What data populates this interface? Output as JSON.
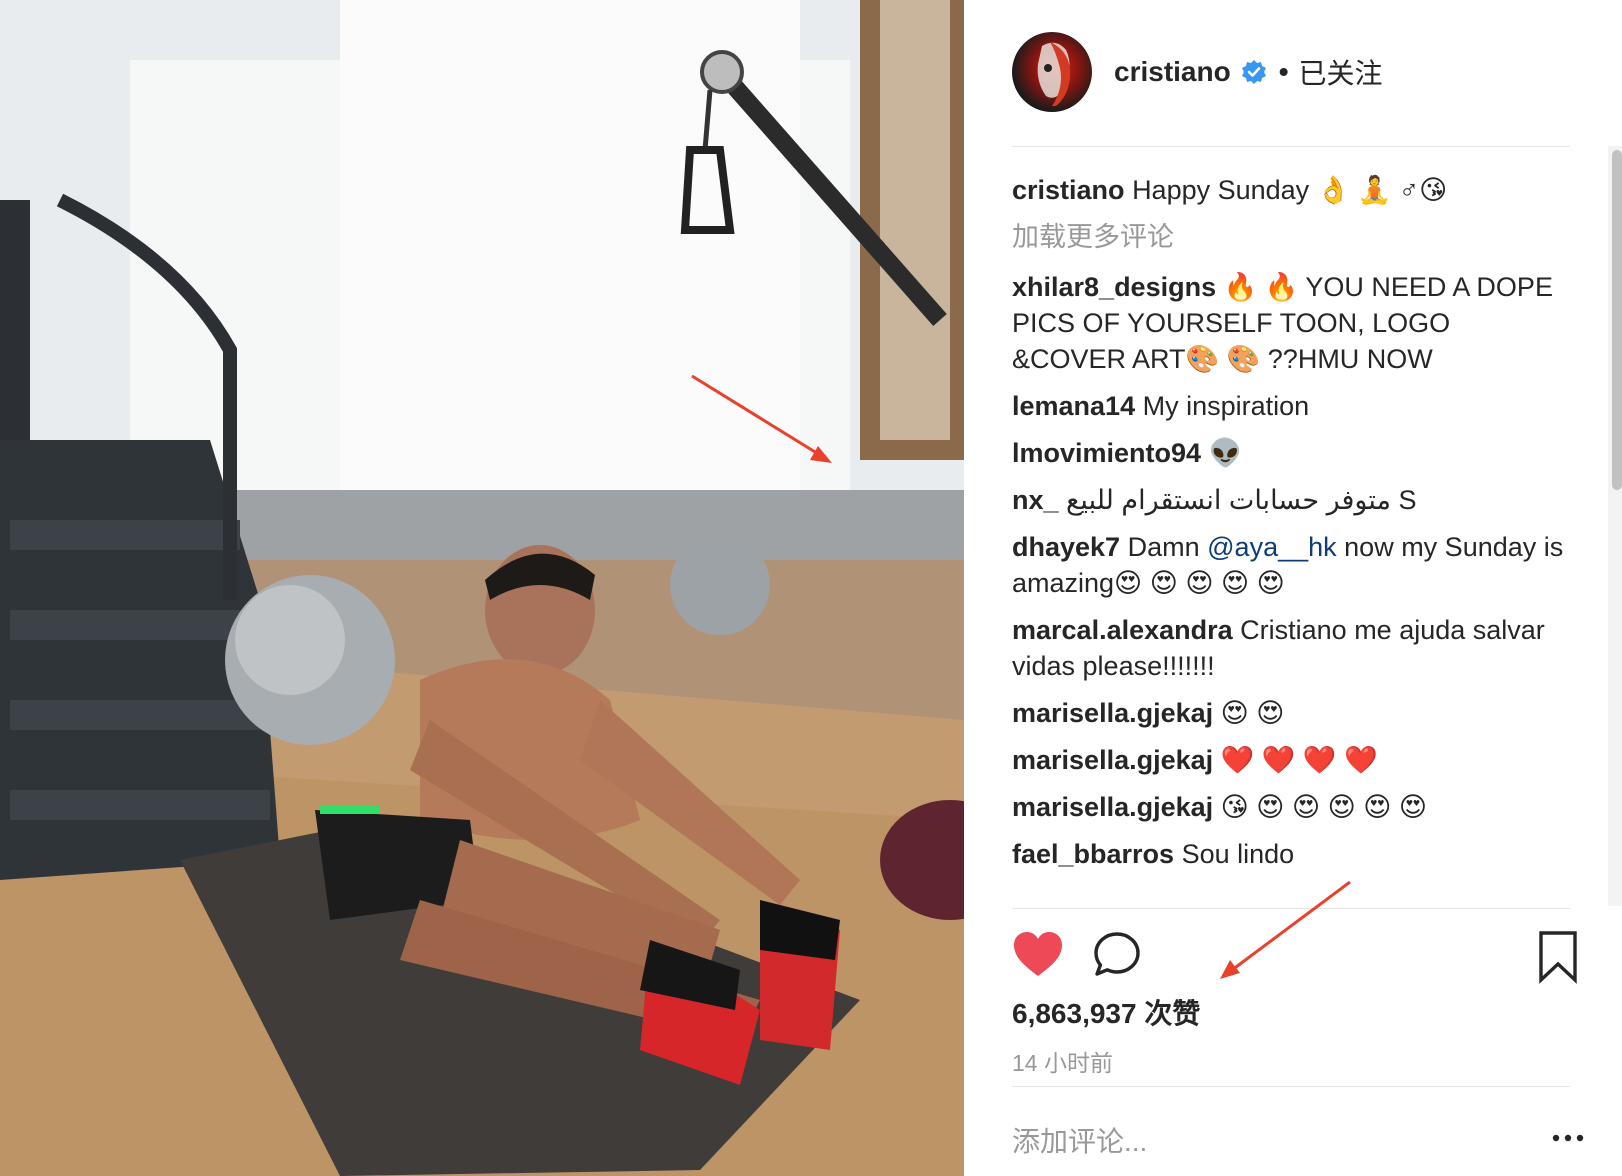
{
  "header": {
    "username": "cristiano",
    "separator": "•",
    "follow_state": "已关注"
  },
  "caption": {
    "user": "cristiano",
    "text": "Happy Sunday 👌 🧘 ♂😘"
  },
  "load_more": "加载更多评论",
  "comments": [
    {
      "user": "xhilar8_designs",
      "text": "🔥 🔥 YOU NEED A DOPE PICS OF YOURSELF TOON, LOGO &COVER ART🎨 🎨 ??HMU NOW"
    },
    {
      "user": "lemana14",
      "text": "My inspiration"
    },
    {
      "user": "lmovimiento94",
      "text": "👽"
    },
    {
      "user": "nx_",
      "text": "متوفر حسابات انستقرام للبيع S"
    },
    {
      "user": "dhayek7",
      "text_before": "Damn",
      "mention": "@aya__hk",
      "text_after": "now my Sunday is amazing😍 😍 😍 😍 😍"
    },
    {
      "user": "marcal.alexandra",
      "text": "Cristiano me ajuda salvar vidas please!!!!!!!"
    },
    {
      "user": "marisella.gjekaj",
      "text": "😍 😍"
    },
    {
      "user": "marisella.gjekaj",
      "text": "❤️ ❤️ ❤️ ❤️"
    },
    {
      "user": "marisella.gjekaj",
      "text": "😘 😍 😍 😍 😍 😍"
    },
    {
      "user": "fael_bbarros",
      "text": "Sou lindo"
    }
  ],
  "likes": "6,863,937 次赞",
  "timestamp": "14 小时前",
  "add_comment_placeholder": "添加评论...",
  "more_label": "•••",
  "colors": {
    "like_red": "#ed4956",
    "verified_blue": "#3897f0",
    "muted": "#999999",
    "arrow_red": "#e8412c"
  },
  "icons": {
    "like": "heart-icon",
    "comment": "speech-bubble-icon",
    "save": "bookmark-icon",
    "verified": "verified-badge-icon",
    "more": "ellipsis-icon"
  }
}
